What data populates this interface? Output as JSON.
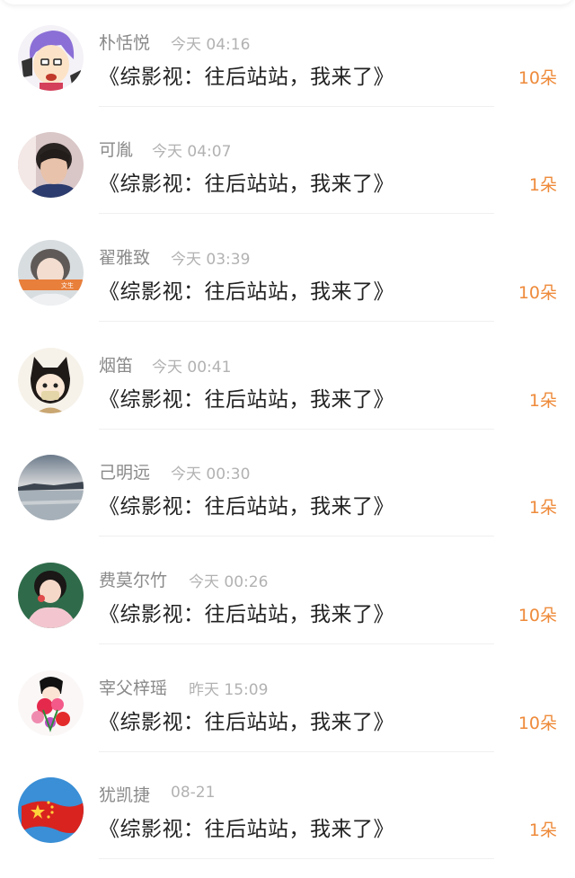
{
  "items": [
    {
      "name": "朴恬悦",
      "time": "今天 04:16",
      "title": "《综影视：往后站站，我来了》",
      "count": "10朵",
      "avatar": "cartoon-purple-hair-avatar"
    },
    {
      "name": "可胤",
      "time": "今天 04:07",
      "title": "《综影视：往后站站，我来了》",
      "count": "1朵",
      "avatar": "young-man-photo-avatar"
    },
    {
      "name": "翟雅致",
      "time": "今天 03:39",
      "title": "《综影视：往后站站，我来了》",
      "count": "10朵",
      "avatar": "boy-with-banner-avatar"
    },
    {
      "name": "烟笛",
      "time": "今天 00:41",
      "title": "《综影视：往后站站，我来了》",
      "count": "1朵",
      "avatar": "cartoon-cat-girl-avatar"
    },
    {
      "name": "己明远",
      "time": "今天 00:30",
      "title": "《综影视：往后站站，我来了》",
      "count": "1朵",
      "avatar": "lake-landscape-avatar"
    },
    {
      "name": "费莫尔竹",
      "time": "今天 00:26",
      "title": "《综影视：往后站站，我来了》",
      "count": "10朵",
      "avatar": "girl-in-pink-avatar"
    },
    {
      "name": "宰父梓瑶",
      "time": "昨天 15:09",
      "title": "《综影视：往后站站，我来了》",
      "count": "10朵",
      "avatar": "flowers-cartoon-avatar"
    },
    {
      "name": "犹凯捷",
      "time": "08-21",
      "title": "《综影视：往后站站，我来了》",
      "count": "1朵",
      "avatar": "red-flag-avatar"
    }
  ]
}
